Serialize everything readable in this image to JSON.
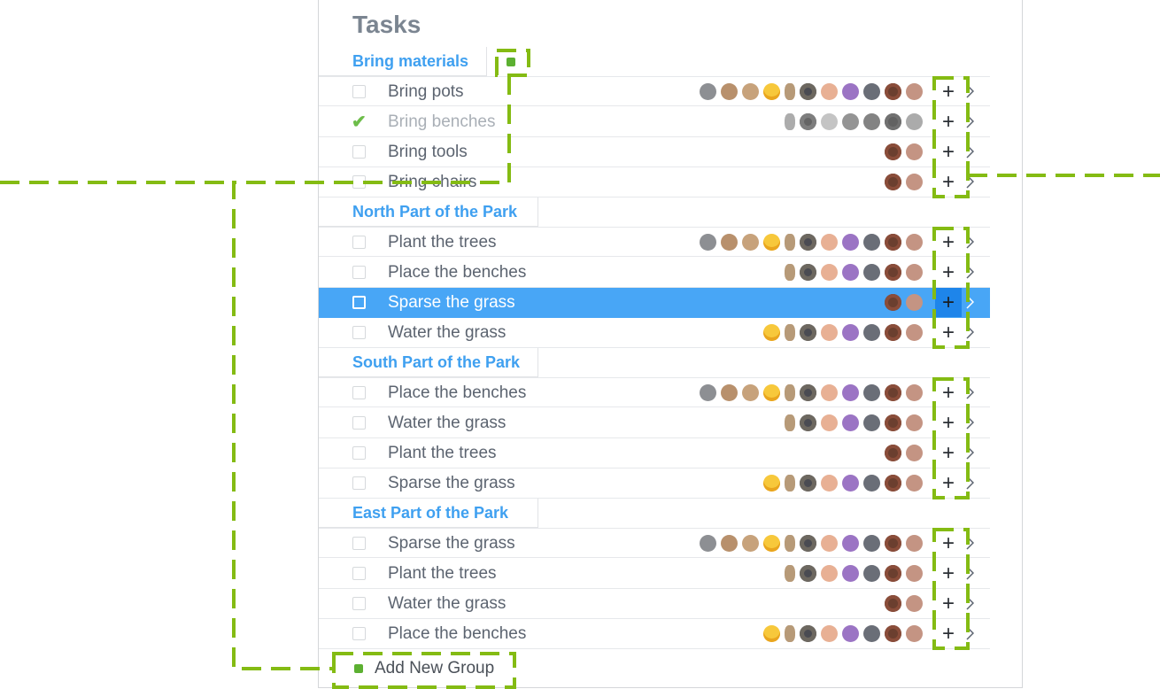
{
  "title": "Tasks",
  "groups": [
    {
      "label": "Bring materials",
      "tasks": [
        {
          "label": "Bring pots",
          "done": false,
          "avatars": 11
        },
        {
          "label": "Bring benches",
          "done": true,
          "avatars": 7
        },
        {
          "label": "Bring tools",
          "done": false,
          "avatars": 2
        },
        {
          "label": "Bring chairs",
          "done": false,
          "avatars": 2
        }
      ]
    },
    {
      "label": "North Part of the Park",
      "tasks": [
        {
          "label": "Plant the trees",
          "done": false,
          "avatars": 11
        },
        {
          "label": "Place the benches",
          "done": false,
          "avatars": 7
        },
        {
          "label": "Sparse the grass",
          "done": false,
          "avatars": 2,
          "selected": true
        },
        {
          "label": "Water the grass",
          "done": false,
          "avatars": 8
        }
      ]
    },
    {
      "label": "South Part of the Park",
      "tasks": [
        {
          "label": "Place the benches",
          "done": false,
          "avatars": 11
        },
        {
          "label": "Water the grass",
          "done": false,
          "avatars": 7
        },
        {
          "label": "Plant the trees",
          "done": false,
          "avatars": 2
        },
        {
          "label": "Sparse the grass",
          "done": false,
          "avatars": 8
        }
      ]
    },
    {
      "label": "East Part of the Park",
      "tasks": [
        {
          "label": "Sparse the grass",
          "done": false,
          "avatars": 11
        },
        {
          "label": "Plant the trees",
          "done": false,
          "avatars": 7
        },
        {
          "label": "Water the grass",
          "done": false,
          "avatars": 2
        },
        {
          "label": "Place the benches",
          "done": false,
          "avatars": 8
        }
      ]
    }
  ],
  "add_task_glyph": "+",
  "add_group_label": "Add New Group",
  "colors": {
    "accent": "#3fa0f0",
    "selected_row": "#48a6f6",
    "annotation": "#84bb13",
    "add_icon": "#5cb031",
    "check": "#6dbd4a"
  }
}
